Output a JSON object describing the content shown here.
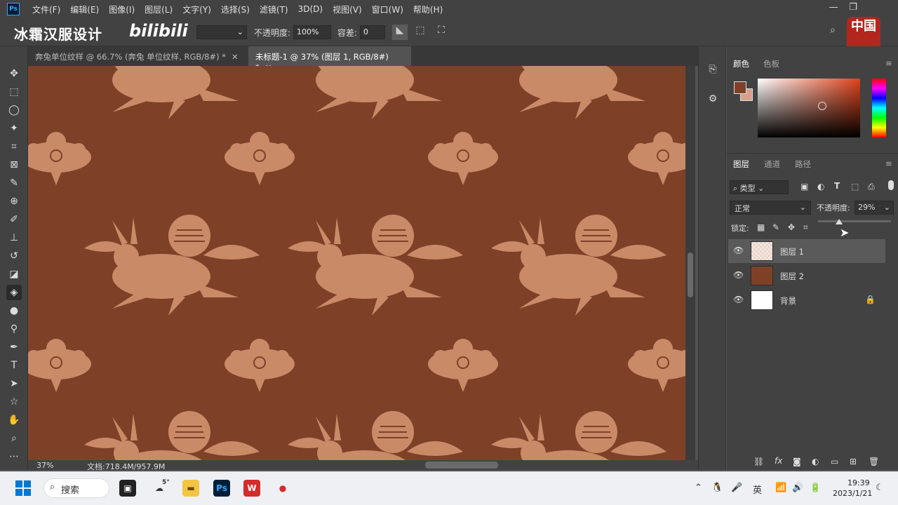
{
  "menubar": {
    "app_logo": "Ps",
    "items": [
      "文件(F)",
      "编辑(E)",
      "图像(I)",
      "图层(L)",
      "文字(Y)",
      "选择(S)",
      "滤镜(T)",
      "3D(D)",
      "视图(V)",
      "窗口(W)",
      "帮助(H)"
    ]
  },
  "window_controls": {
    "minimize": "—",
    "restore": "❐",
    "close": "✕"
  },
  "options_bar": {
    "opacity_label": "不透明度:",
    "opacity_value": "100%",
    "tolerance_label": "容差:",
    "tolerance_value": "0"
  },
  "overlay": {
    "watermark": "冰霜汉服设计",
    "bilibili": "bilibili",
    "seal_text": "中国"
  },
  "tabs": [
    {
      "label": "奔兔单位纹样 @ 66.7% (奔兔 单位纹样, RGB/8#) *",
      "active": false
    },
    {
      "label": "未标题-1 @ 37% (图层 1, RGB/8#) *",
      "active": true
    }
  ],
  "status": {
    "zoom": "37%",
    "doc_size": "文档:718.4M/957.9M"
  },
  "color_panel": {
    "tabs": [
      "颜色",
      "色板"
    ],
    "foreground": "#7e4128",
    "background": "#d8a08a"
  },
  "layers_panel": {
    "tabs": [
      "图层",
      "通道",
      "路径"
    ],
    "filter_label": "类型",
    "blend_mode": "正常",
    "opacity_label": "不透明度:",
    "opacity_value": "29%",
    "opacity_fraction": 0.29,
    "lock_label": "锁定:",
    "layers": [
      {
        "name": "图层 1",
        "selected": true,
        "locked": false
      },
      {
        "name": "图层 2",
        "selected": false,
        "locked": false
      },
      {
        "name": "背景",
        "selected": false,
        "locked": true
      }
    ]
  },
  "taskbar": {
    "search_label": "搜索",
    "weather": "5°",
    "ime": "英",
    "time": "19:39",
    "date": "2023/1/21"
  },
  "colors": {
    "canvas_bg": "#7e4128",
    "pattern": "#c98a68",
    "accent": "#31a8ff"
  }
}
